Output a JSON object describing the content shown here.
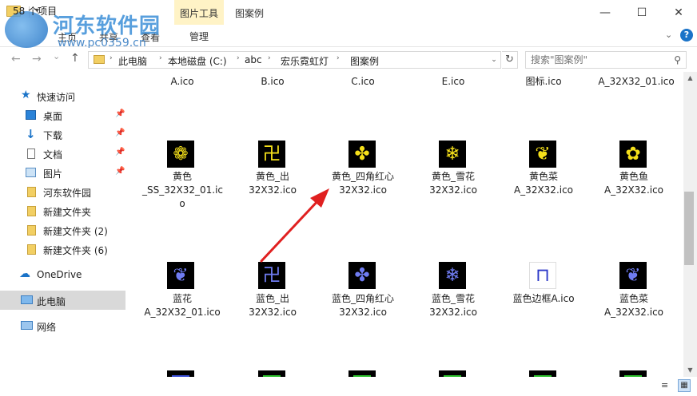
{
  "window": {
    "context_tab": "图片工具",
    "title": "图案例",
    "tabs": [
      "主页",
      "共享",
      "查看",
      "管理"
    ],
    "minimize": "—",
    "maximize": "☐",
    "close": "✕",
    "help": "?"
  },
  "watermark": {
    "site_name": "河东软件园",
    "url": "www.pc0359.cn"
  },
  "nav_buttons": {
    "back": "←",
    "forward": "→",
    "recent": "⌄",
    "up": "↑"
  },
  "address": {
    "crumbs": [
      "此电脑",
      "本地磁盘 (C:)",
      "abc",
      "宏乐霓虹灯",
      "图案例"
    ],
    "separator": "›",
    "dropdown": "⌄",
    "refresh": "↻"
  },
  "search": {
    "placeholder": "搜索\"图案例\"",
    "icon": "⚲"
  },
  "sidebar": {
    "items": [
      {
        "label": "快速访问",
        "icon": "star-icon"
      },
      {
        "label": "桌面",
        "icon": "desktop-icon",
        "pinned": true
      },
      {
        "label": "下载",
        "icon": "download-icon",
        "pinned": true
      },
      {
        "label": "文档",
        "icon": "document-icon",
        "pinned": true
      },
      {
        "label": "图片",
        "icon": "pictures-icon",
        "pinned": true
      },
      {
        "label": "河东软件园",
        "icon": "folder-icon"
      },
      {
        "label": "新建文件夹",
        "icon": "folder-icon"
      },
      {
        "label": "新建文件夹 (2)",
        "icon": "folder-icon"
      },
      {
        "label": "新建文件夹 (6)",
        "icon": "folder-icon"
      },
      {
        "label": "OneDrive",
        "icon": "cloud-icon"
      },
      {
        "label": "此电脑",
        "icon": "computer-icon",
        "selected": true
      },
      {
        "label": "网络",
        "icon": "network-icon"
      }
    ],
    "pin_glyph": "📌"
  },
  "files": {
    "row1": [
      "A.ico",
      "B.ico",
      "C.ico",
      "E.ico",
      "图标.ico",
      "A_32X32_01.ico"
    ],
    "row2": [
      {
        "line1": "黄色",
        "line2": "_SS_32X32_01.ic",
        "line3": "o",
        "color": "#f5e01a",
        "glyph": "❁"
      },
      {
        "line1": "黄色_出",
        "line2": "32X32.ico",
        "line3": "",
        "color": "#f5e01a",
        "glyph": "卍"
      },
      {
        "line1": "黄色_四角红心",
        "line2": "32X32.ico",
        "line3": "",
        "color": "#f5e01a",
        "glyph": "✤"
      },
      {
        "line1": "黄色_雪花",
        "line2": "32X32.ico",
        "line3": "",
        "color": "#f5e01a",
        "glyph": "❄"
      },
      {
        "line1": "黄色菜",
        "line2": "A_32X32.ico",
        "line3": "",
        "color": "#f5e01a",
        "glyph": "❦"
      },
      {
        "line1": "黄色鱼",
        "line2": "A_32X32.ico",
        "line3": "",
        "color": "#f5e01a",
        "glyph": "✿"
      }
    ],
    "row3": [
      {
        "line1": "蓝花",
        "line2": "A_32X32_01.ico",
        "color": "#6f7cf2",
        "glyph": "❦"
      },
      {
        "line1": "蓝色_出",
        "line2": "32X32.ico",
        "color": "#6f7cf2",
        "glyph": "卍"
      },
      {
        "line1": "蓝色_四角红心",
        "line2": "32X32.ico",
        "color": "#6f7cf2",
        "glyph": "✤"
      },
      {
        "line1": "蓝色_雪花",
        "line2": "32X32.ico",
        "color": "#6f7cf2",
        "glyph": "❄"
      },
      {
        "line1": "蓝色边框A.ico",
        "line2": "",
        "color": "#2d39c8",
        "glyph": "⊓"
      },
      {
        "line1": "蓝色菜",
        "line2": "A_32X32.ico",
        "color": "#6f7cf2",
        "glyph": "❦"
      }
    ],
    "row4_colors": [
      "#3b50d8",
      "#2ec22e",
      "#2ec22e",
      "#2ec22e",
      "#2ec22e",
      "#2ec22e"
    ]
  },
  "status": {
    "item_count": "58 个项目",
    "details_view_icon": "≡",
    "large_icons_view_icon": "▦"
  },
  "annotation": {
    "arrow_color": "#e02020"
  }
}
